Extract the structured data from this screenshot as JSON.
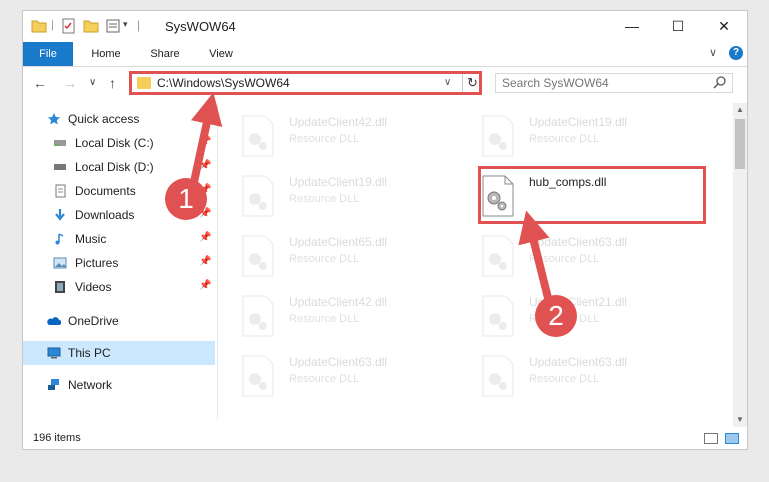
{
  "window": {
    "title": "SysWOW64",
    "controls": {
      "minimize": "—",
      "maximize": "☐",
      "close": "✕"
    }
  },
  "ribbon": {
    "tabs": [
      "File",
      "Home",
      "Share",
      "View"
    ],
    "collapse_glyph": "∨",
    "help_glyph": "?"
  },
  "navbar": {
    "back": "←",
    "forward": "→",
    "recent": "∨",
    "up": "↑",
    "address": "C:\\Windows\\SysWOW64",
    "dropdown": "∨",
    "refresh": "↻",
    "search_placeholder": "Search SysWOW64"
  },
  "navpane": {
    "items": [
      {
        "label": "Quick access",
        "icon": "star-icon"
      },
      {
        "label": "Local Disk (C:)",
        "icon": "drive-icon",
        "pinned": true
      },
      {
        "label": "Local Disk (D:)",
        "icon": "drive-icon",
        "pinned": true
      },
      {
        "label": "Documents",
        "icon": "documents-icon",
        "pinned": true
      },
      {
        "label": "Downloads",
        "icon": "downloads-icon",
        "pinned": true
      },
      {
        "label": "Music",
        "icon": "music-icon",
        "pinned": true
      },
      {
        "label": "Pictures",
        "icon": "pictures-icon",
        "pinned": true
      },
      {
        "label": "Videos",
        "icon": "videos-icon",
        "pinned": true
      },
      {
        "label": "OneDrive",
        "icon": "onedrive-icon"
      },
      {
        "label": "This PC",
        "icon": "computer-icon",
        "selected": true
      },
      {
        "label": "Network",
        "icon": "network-icon"
      }
    ]
  },
  "files": {
    "left_column": [
      {
        "name": "UpdateClient42.dll",
        "type": "Resource DLL"
      },
      {
        "name": "UpdateClient19.dll",
        "type": "Resource DLL"
      },
      {
        "name": "UpdateClient65.dll",
        "type": "Resource DLL"
      },
      {
        "name": "UpdateClient42.dll",
        "type": "Resource DLL"
      },
      {
        "name": "UpdateClient63.dll",
        "type": "Resource DLL"
      }
    ],
    "right_column": [
      {
        "name": "UpdateClient19.dll",
        "type": "Resource DLL"
      },
      {
        "name": "hub_comps.dll",
        "type": ""
      },
      {
        "name": "UpdateClient63.dll",
        "type": "Resource DLL"
      },
      {
        "name": "UpdateClient21.dll",
        "type": "Resource DLL"
      },
      {
        "name": "UpdateClient63.dll",
        "type": "Resource DLL"
      }
    ]
  },
  "status": {
    "item_count": "196 items"
  },
  "annotations": {
    "step1": "1",
    "step2": "2",
    "color": "#e05252"
  }
}
